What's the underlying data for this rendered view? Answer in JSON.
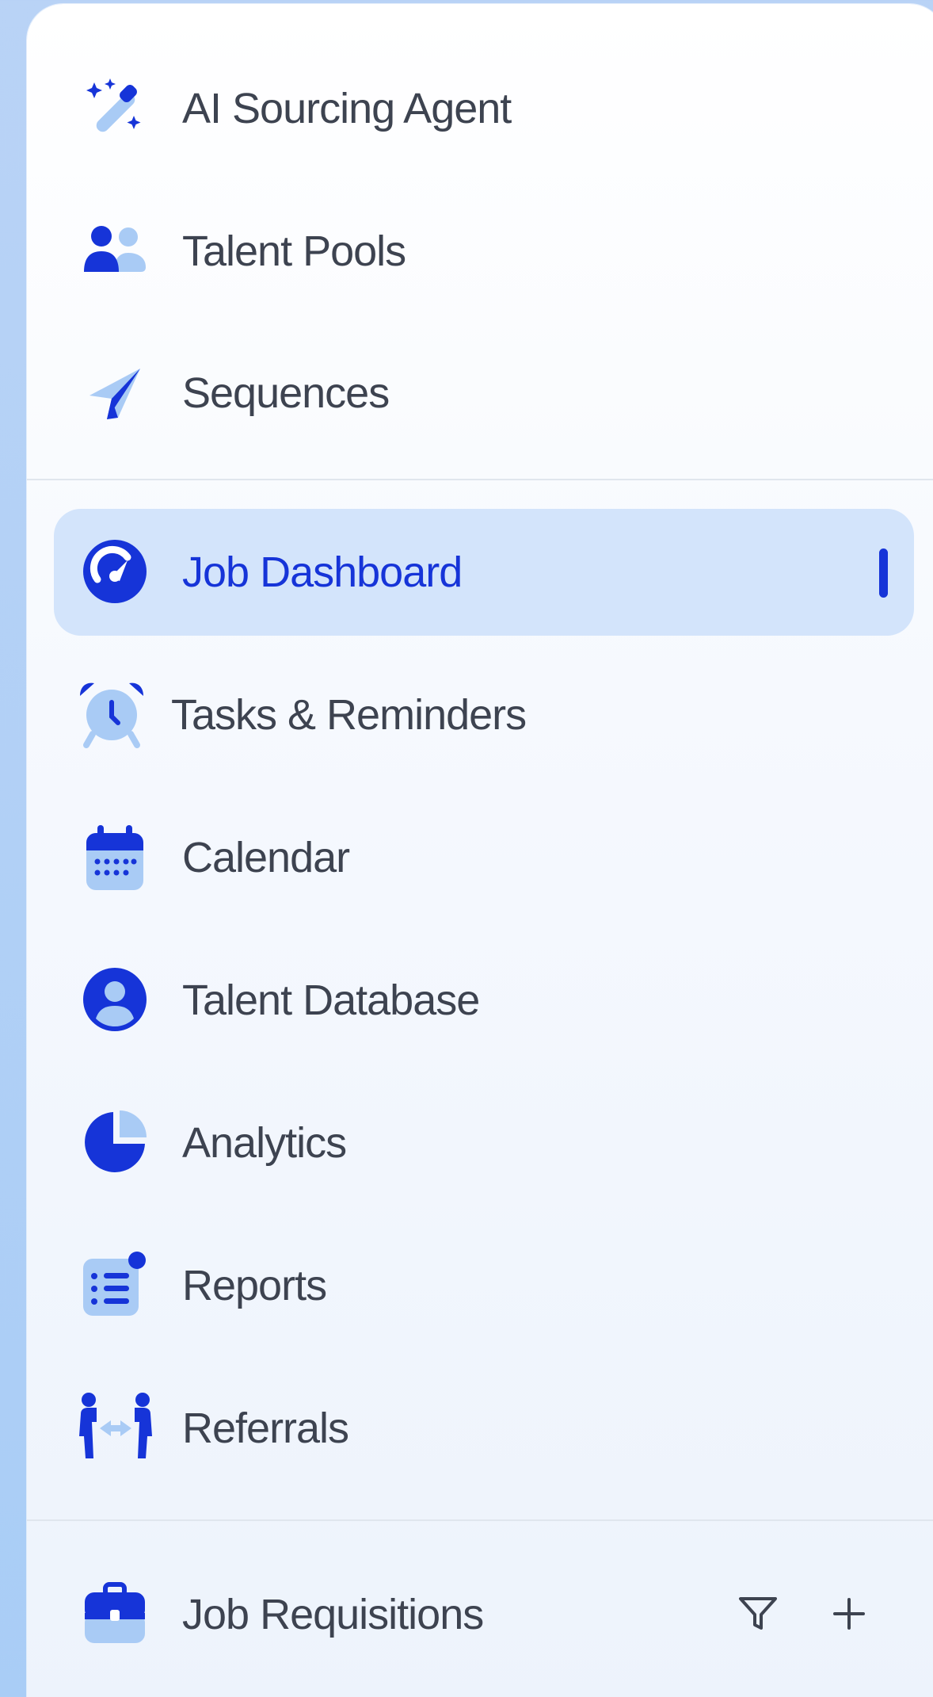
{
  "nav": {
    "top_items": [
      {
        "label": "AI Sourcing Agent",
        "icon": "magic-wand-sparkles-icon"
      },
      {
        "label": "Talent Pools",
        "icon": "users-group-icon"
      },
      {
        "label": "Sequences",
        "icon": "paper-plane-icon"
      }
    ],
    "main_items": [
      {
        "label": "Job Dashboard",
        "icon": "gauge-icon",
        "active": true
      },
      {
        "label": "Tasks & Reminders",
        "icon": "alarm-clock-icon"
      },
      {
        "label": "Calendar",
        "icon": "calendar-icon"
      },
      {
        "label": "Talent Database",
        "icon": "user-circle-icon"
      },
      {
        "label": "Analytics",
        "icon": "pie-chart-icon"
      },
      {
        "label": "Reports",
        "icon": "report-list-icon"
      },
      {
        "label": "Referrals",
        "icon": "referral-people-icon"
      }
    ],
    "section": {
      "label": "Job Requisitions",
      "icon": "briefcase-icon",
      "filter_icon": "filter-icon",
      "add_icon": "plus-icon"
    }
  },
  "colors": {
    "accent": "#1634d8",
    "accent_light": "#a9cbf5",
    "active_bg": "#d3e4fb",
    "text": "#3d4350",
    "active_text": "#1634d8"
  }
}
